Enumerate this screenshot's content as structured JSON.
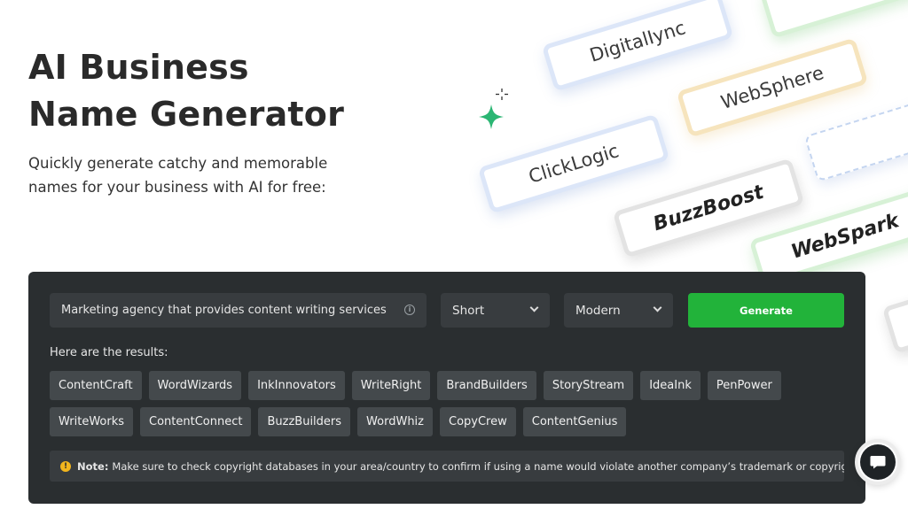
{
  "hero": {
    "title_line1": "AI Business",
    "title_line2": "Name Generator",
    "subtitle": "Quickly generate catchy and memorable names for your business with AI for free:"
  },
  "cards": [
    "DigitalIync",
    "WebSphere",
    "ClickLogic",
    "BuzzBoost",
    "WebSpark"
  ],
  "form": {
    "prompt_value": "Marketing agency that provides content writing services",
    "length_value": "Short",
    "style_value": "Modern",
    "generate_label": "Generate"
  },
  "results": {
    "label": "Here are the results:",
    "row1": [
      "ContentCraft",
      "WordWizards",
      "InkInnovators",
      "WriteRight",
      "BrandBuilders",
      "StoryStream",
      "IdeaInk",
      "PenPower"
    ],
    "row2": [
      "WriteWorks",
      "ContentConnect",
      "BuzzBuilders",
      "WordWhiz",
      "CopyCrew",
      "ContentGenius"
    ]
  },
  "note": {
    "bold": "Note:",
    "text": "Make sure to check copyright databases in your area/country to confirm if using a name would violate another company’s trademark or copyright."
  },
  "colors": {
    "panel_bg": "#2a2e30",
    "accent_green": "#22b33a",
    "warning_yellow": "#f2b51d"
  },
  "icons": [
    "info-icon",
    "chevron-down-icon",
    "warning-icon",
    "chat-bubble-icon",
    "sparkle-icon"
  ]
}
